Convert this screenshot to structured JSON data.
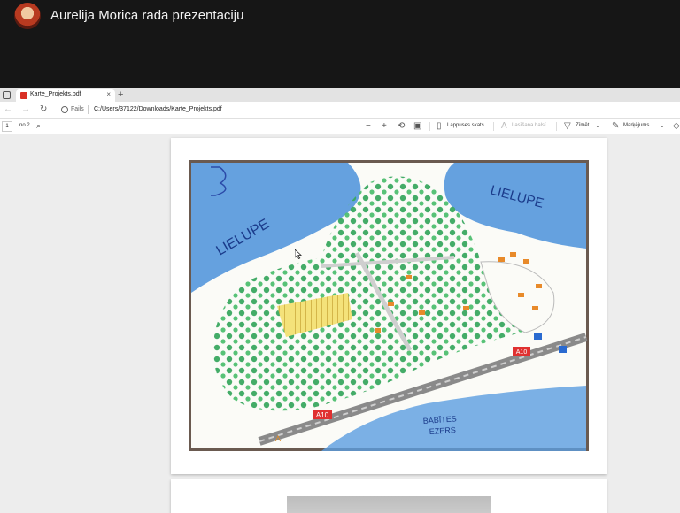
{
  "share": {
    "presenter_title": "Aurēlija Morica rāda prezentāciju"
  },
  "tab": {
    "title": "Karte_Projekts.pdf",
    "close_glyph": "×",
    "new_tab_glyph": "+"
  },
  "address": {
    "label": "Fails",
    "url": "C:/Users/37122/Downloads/Karte_Projekts.pdf"
  },
  "toolbar": {
    "page_current": "1",
    "page_total": "no 2",
    "page_view_label": "Lappuses skats",
    "read_aloud_label": "Lasīšana balsī",
    "draw_label": "Zīmēt",
    "highlight_label": "Marķējums"
  },
  "map": {
    "label_left": "LIELUPE",
    "label_right": "LIELUPE",
    "label_lake_1": "BABĪTES",
    "label_lake_2": "EZERS",
    "road_sign_1": "A10",
    "road_sign_2": "A10",
    "marker": "Λ"
  },
  "colors": {
    "share_bg": "#161616",
    "river_blue": "#3b82d0",
    "tree_green": "#3aa860",
    "road_gray": "#8a8a8a",
    "sign_red": "#e03030",
    "house_orange": "#e88a2a"
  }
}
